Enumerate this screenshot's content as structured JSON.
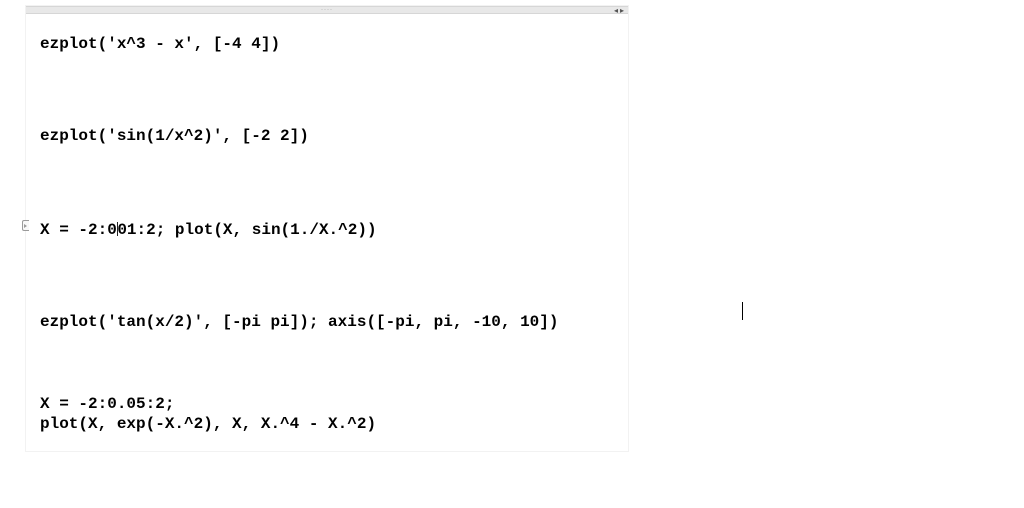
{
  "titlebar": {
    "dots": "····",
    "nav_left": "◂",
    "nav_right": "▸"
  },
  "cells": {
    "c1": "ezplot('x^3 - x', [-4 4])",
    "c2": "ezplot('sin(1/x^2)', [-2 2])",
    "c3_a": "X = -2:0",
    "c3_b": "01:2; plot(X, sin(1./X.^2))",
    "c4": "ezplot('tan(x/2)', [-pi pi]); axis([-pi, pi, -10, 10])",
    "c5_line1": "X = -2:0.05:2;",
    "c5_line2": "plot(X, exp(-X.^2), X, X.^4 - X.^2)"
  }
}
